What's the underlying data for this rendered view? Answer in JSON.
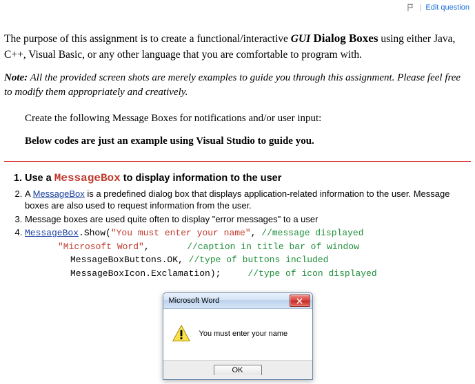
{
  "topbar": {
    "edit_link": "Edit question"
  },
  "intro": {
    "before_gui": "The purpose of this assignment is to create a functional/interactive ",
    "gui": "GUI",
    "dialog": " Dialog Boxes",
    "rest": " using either Java, C++, Visual Basic, or any other language that you are comfortable to program with."
  },
  "note": {
    "label": "Note:",
    "text": " All the provided screen shots are merely examples to guide you through this assignment. Please feel free to modify them appropriately and creatively."
  },
  "indented": {
    "line1": "Create the following Message Boxes for notifications and/or user input:",
    "line2": "Below codes are just an example using Visual Studio to guide you."
  },
  "list": {
    "item1_before": "Use a ",
    "item1_mb": "MessageBox",
    "item1_after": " to display information to the user",
    "item2_link": "MessageBox",
    "item2_before": "A ",
    "item2_after": " is a predefined dialog box that displays application-related information to the user. Message boxes are also used to request information from the user.",
    "item3": "Message boxes are used quite often to display \"error messages\" to a user"
  },
  "code": {
    "l1_mb": "MessageBox",
    "l1_show": ".Show(",
    "l1_str": "\"You must enter your name\"",
    "l1_comma": ", ",
    "l1_cmt": "//message displayed",
    "l2_str": "\"Microsoft Word\"",
    "l2_comma": ",       ",
    "l2_cmt": "//caption in title bar of window",
    "l3_txt": "MessageBoxButtons.OK, ",
    "l3_cmt": "//type of buttons included",
    "l4_txt": "MessageBoxIcon.Exclamation);     ",
    "l4_cmt": "//type of icon displayed"
  },
  "msgbox": {
    "title": "Microsoft Word",
    "message": "You must enter your name",
    "ok_label": "OK"
  }
}
